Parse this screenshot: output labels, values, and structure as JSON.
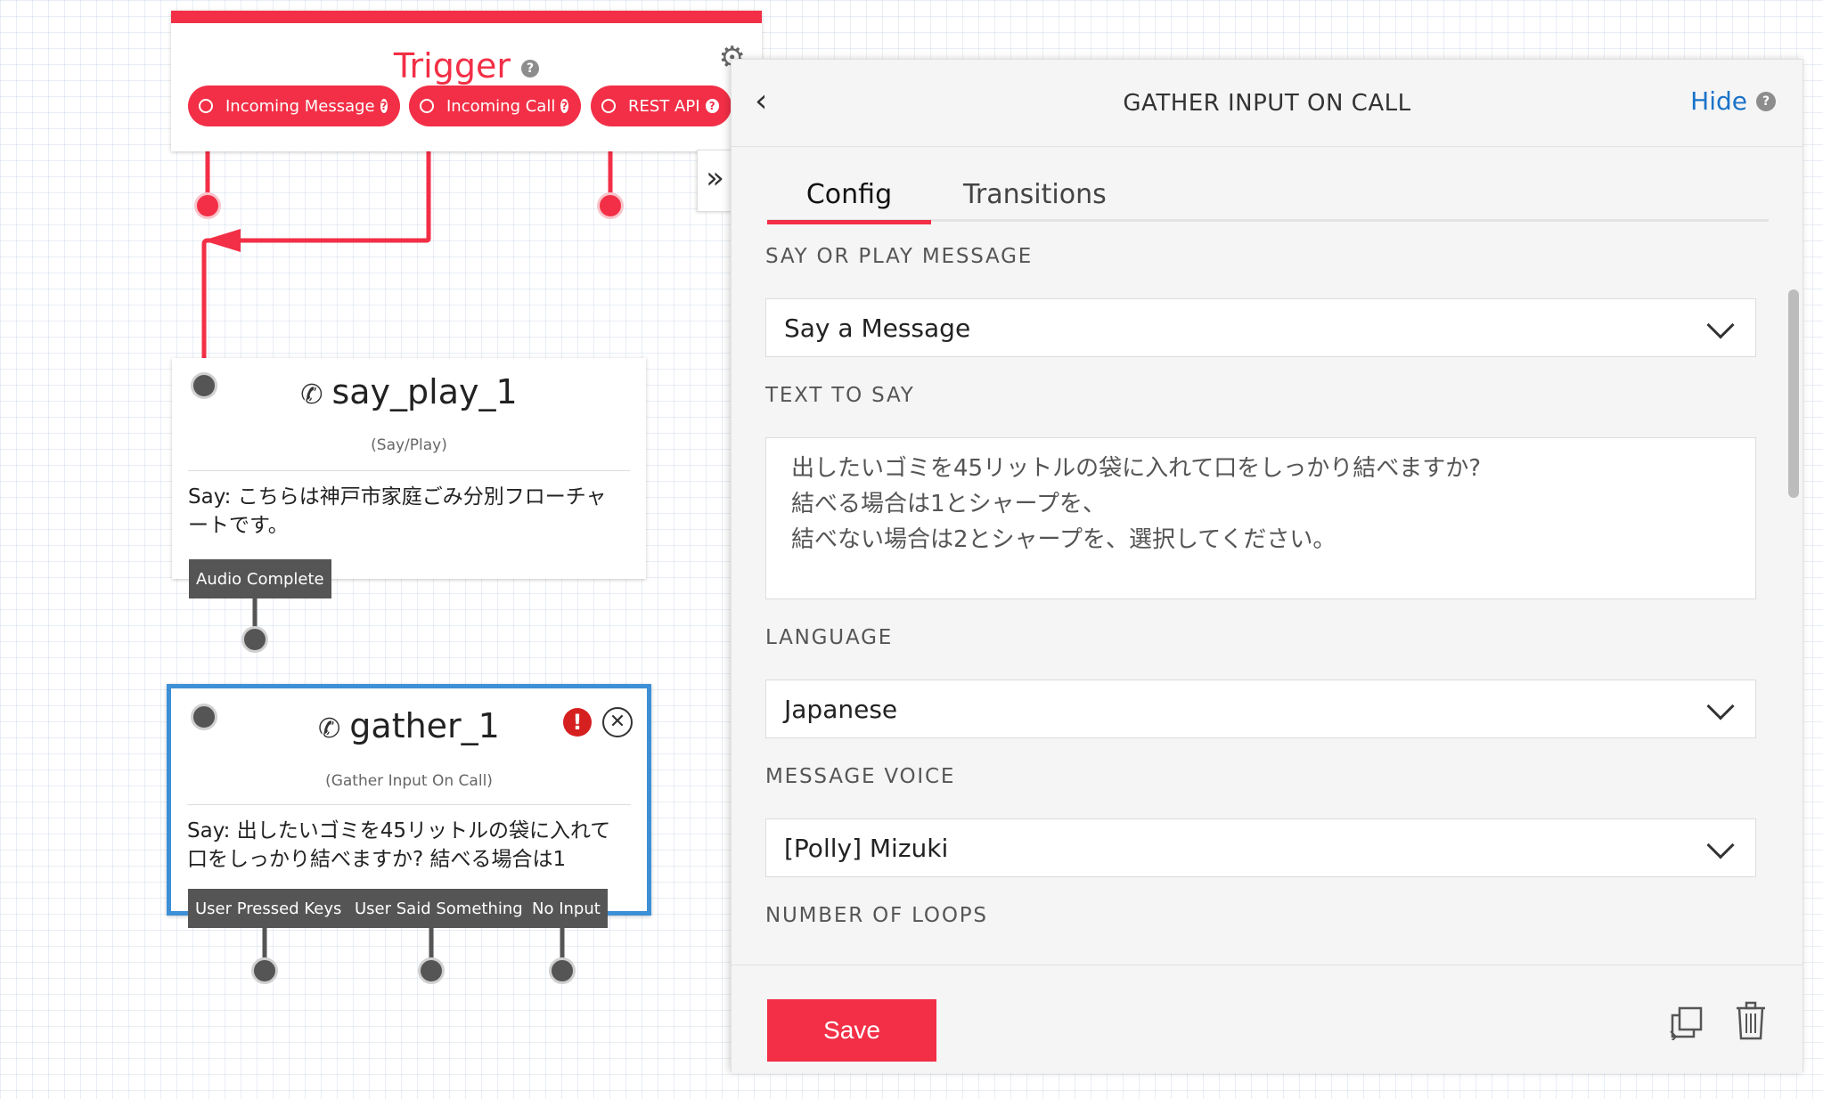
{
  "trigger": {
    "title": "Trigger",
    "help_icon": "question-circle-icon",
    "settings_icon": "gears-icon",
    "pills": [
      {
        "label": "Incoming Message"
      },
      {
        "label": "Incoming Call"
      },
      {
        "label": "REST API"
      }
    ]
  },
  "say_play_node": {
    "title": "say_play_1",
    "icon": "phone-icon",
    "type": "(Say/Play)",
    "body": "Say: こちらは神戸市家庭ごみ分別フローチャートです。",
    "outputs": [
      "Audio Complete"
    ]
  },
  "gather_node": {
    "title": "gather_1",
    "icon": "phone-icon",
    "type": "(Gather Input On Call)",
    "body": "Say: 出したいゴミを45リットルの袋に入れて口をしっかり結べますか? 結べる場合は1",
    "outputs": [
      "User Pressed Keys",
      "User Said Something",
      "No Input"
    ],
    "warning_icon": "exclamation-icon",
    "close_icon": "close-circle-icon"
  },
  "panel": {
    "back_icon": "chevron-left-icon",
    "title": "GATHER INPUT ON CALL",
    "hide_label": "Hide",
    "collapse_icon": "double-chevron-right-icon",
    "tabs": [
      {
        "label": "Config",
        "active": true
      },
      {
        "label": "Transitions",
        "active": false
      }
    ],
    "fields": {
      "say_or_play": {
        "label": "SAY OR PLAY MESSAGE",
        "value": "Say a Message"
      },
      "text_to_say": {
        "label": "TEXT TO SAY",
        "value": "出したいゴミを45リットルの袋に入れて口をしっかり結べますか?\n結べる場合は1とシャープを、\n結べない場合は2とシャープを、選択してください。"
      },
      "language": {
        "label": "LANGUAGE",
        "value": "Japanese"
      },
      "message_voice": {
        "label": "MESSAGE VOICE",
        "value": "[Polly] Mizuki"
      },
      "number_of_loops": {
        "label": "NUMBER OF LOOPS"
      }
    },
    "save_label": "Save",
    "duplicate_icon": "duplicate-icon",
    "delete_icon": "trash-icon"
  },
  "colors": {
    "brand_red": "#f22f46",
    "selected_blue": "#3d8fd6",
    "link_blue": "#1a73c9",
    "connector_gray": "#555555"
  }
}
